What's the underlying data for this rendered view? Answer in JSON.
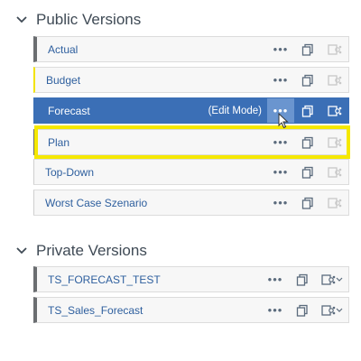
{
  "public_versions": {
    "title": "Public Versions",
    "items": [
      {
        "label": "Actual"
      },
      {
        "label": "Budget"
      },
      {
        "label": "Forecast",
        "status": "(Edit Mode)"
      },
      {
        "label": "Plan"
      },
      {
        "label": "Top-Down"
      },
      {
        "label": "Worst Case Szenario"
      }
    ]
  },
  "private_versions": {
    "title": "Private Versions",
    "items": [
      {
        "label": "TS_FORECAST_TEST"
      },
      {
        "label": "TS_Sales_Forecast"
      }
    ]
  },
  "icons": {
    "more": "more-options-icon",
    "copy": "copy-icon",
    "share": "share-icon",
    "section_toggle": "chevron-down-icon"
  },
  "colors": {
    "selected_row": "#3b6fb6",
    "highlight": "#f5e800",
    "link_text": "#2e5f9e"
  }
}
